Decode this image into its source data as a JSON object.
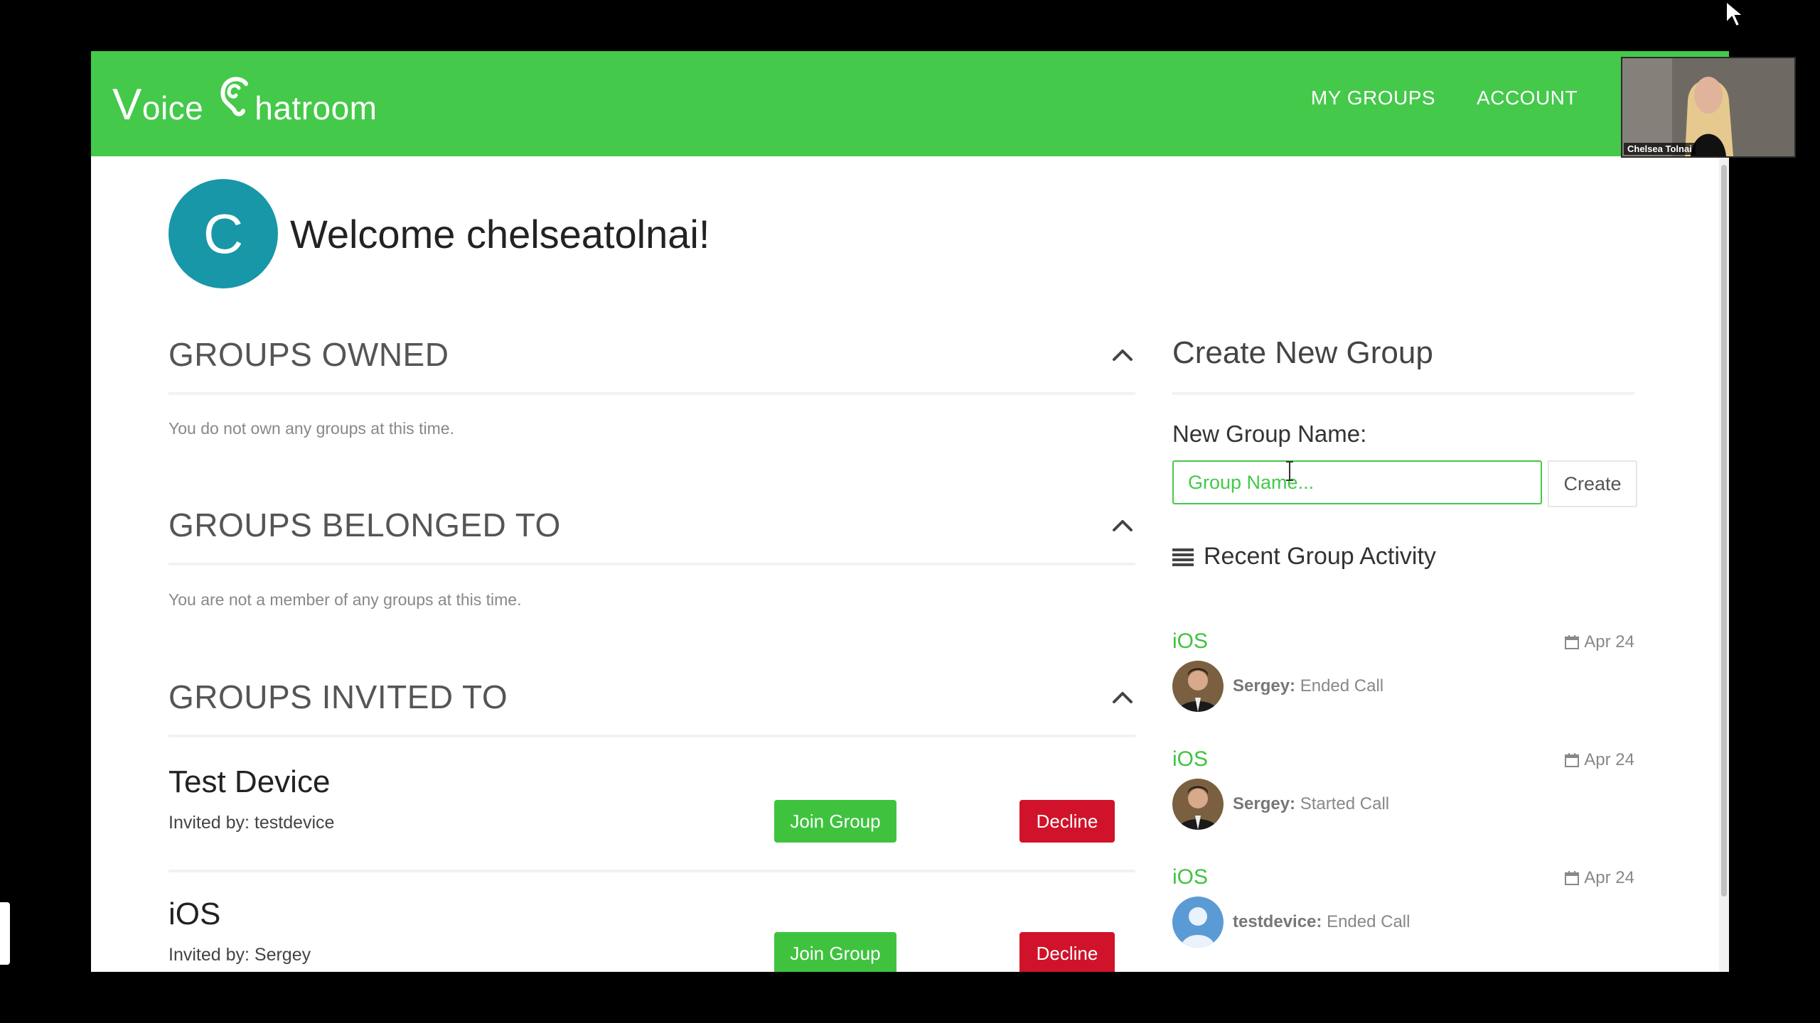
{
  "header": {
    "logo_v": "V",
    "logo_oice": "oice",
    "logo_hatroom": "hatroom",
    "nav": [
      "MY GROUPS",
      "ACCOUNT"
    ]
  },
  "profile": {
    "initial": "C",
    "welcome": "Welcome chelseatolnai!"
  },
  "sections": {
    "owned": {
      "title": "GROUPS OWNED",
      "empty": "You do not own any groups at this time."
    },
    "belonged": {
      "title": "GROUPS BELONGED TO",
      "empty": "You are not a member of any groups at this time."
    },
    "invited": {
      "title": "GROUPS INVITED TO"
    }
  },
  "invites": [
    {
      "name": "Test Device",
      "invited_by": "Invited by: testdevice",
      "join": "Join Group",
      "decline": "Decline"
    },
    {
      "name": "iOS",
      "invited_by": "Invited by: Sergey",
      "join": "Join Group",
      "decline": "Decline"
    }
  ],
  "create_group": {
    "title": "Create New Group",
    "label": "New Group Name:",
    "placeholder": "Group Name...",
    "button": "Create"
  },
  "recent_activity": {
    "title": "Recent Group Activity",
    "items": [
      {
        "group": "iOS",
        "date": "Apr 24",
        "user": "Sergey:",
        "action": "Ended Call",
        "avatar": "photo"
      },
      {
        "group": "iOS",
        "date": "Apr 24",
        "user": "Sergey:",
        "action": "Started Call",
        "avatar": "photo"
      },
      {
        "group": "iOS",
        "date": "Apr 24",
        "user": "testdevice:",
        "action": "Ended Call",
        "avatar": "default"
      }
    ]
  },
  "video_overlay": {
    "name": "Chelsea Tolnai"
  },
  "colors": {
    "brand_green": "#44c94a",
    "join_green": "#3fc33f",
    "decline_red": "#d0132a",
    "avatar_teal": "#1897a8"
  }
}
